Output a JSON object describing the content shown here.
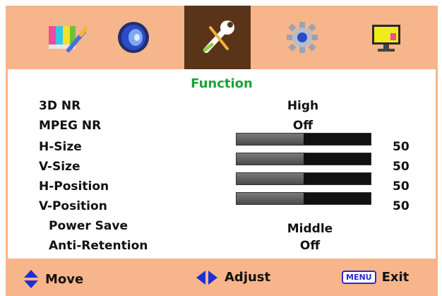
{
  "tabs": [
    {
      "name": "picture",
      "icon": "picture-icon",
      "active": false
    },
    {
      "name": "sound",
      "icon": "speaker-icon",
      "active": false
    },
    {
      "name": "function",
      "icon": "wrench-icon",
      "active": true
    },
    {
      "name": "setup",
      "icon": "gear-icon",
      "active": false
    },
    {
      "name": "display",
      "icon": "monitor-icon",
      "active": false
    }
  ],
  "panel": {
    "title": "Function",
    "rows": [
      {
        "label": "3D NR",
        "type": "value",
        "value": "High"
      },
      {
        "label": "MPEG NR",
        "type": "value",
        "value": "Off"
      },
      {
        "label": "H-Size",
        "type": "slider",
        "value": "50",
        "level": 0.5
      },
      {
        "label": "V-Size",
        "type": "slider",
        "value": "50",
        "level": 0.5
      },
      {
        "label": "H-Position",
        "type": "slider",
        "value": "50",
        "level": 0.5
      },
      {
        "label": "V-Position",
        "type": "slider",
        "value": "50",
        "level": 0.5
      },
      {
        "label": "Power Save",
        "type": "value",
        "value": "Middle"
      },
      {
        "label": "Anti-Retention",
        "type": "value",
        "value": "Off"
      }
    ]
  },
  "hints": {
    "move": "Move",
    "adjust": "Adjust",
    "menu_key": "MENU",
    "exit": "Exit"
  },
  "colors": {
    "bar_bg": "#f6b58a",
    "active_tab": "#5a3418",
    "title_green": "#1aa33a",
    "arrow_blue": "#1f2fd6"
  }
}
